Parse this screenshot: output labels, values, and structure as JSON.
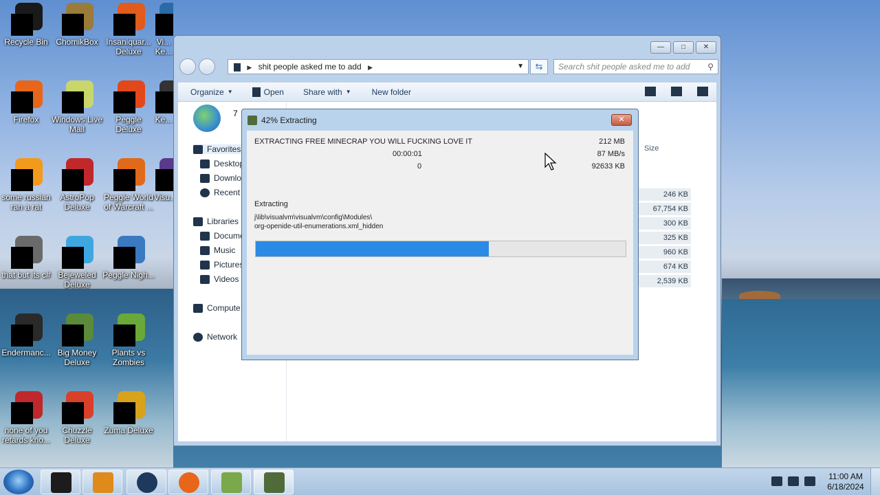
{
  "desktop": {
    "icons": [
      {
        "label": "Recycle Bin",
        "color": "#1a1a1a"
      },
      {
        "label": "ChomikBox",
        "color": "#9a7b3a"
      },
      {
        "label": "Insaniquar... Deluxe",
        "color": "#e25a1c"
      },
      {
        "label": "Vi... Ke...",
        "color": "#2a6aa8"
      },
      {
        "label": "Firefox",
        "color": "#e8661a"
      },
      {
        "label": "Windows Live Mail",
        "color": "#c9d66b"
      },
      {
        "label": "Peggle Deluxe",
        "color": "#e2481a"
      },
      {
        "label": "Ke...",
        "color": "#333333"
      },
      {
        "label": "some russian ran a rat",
        "color": "#f29a1c"
      },
      {
        "label": "AstroPop Deluxe",
        "color": "#c0282c"
      },
      {
        "label": "Peggle World of Warcraft ...",
        "color": "#e06a1a"
      },
      {
        "label": "Visu...",
        "color": "#5a3a8a"
      },
      {
        "label": "that but its c#",
        "color": "#6a6a6a"
      },
      {
        "label": "Bejeweled Deluxe",
        "color": "#3fa7e0"
      },
      {
        "label": "Peggle Nigh...",
        "color": "#3a7ac0"
      },
      {
        "label": "Endermanc...",
        "color": "#2a2a2a"
      },
      {
        "label": "Big Money Deluxe",
        "color": "#5a8a3a"
      },
      {
        "label": "Plants vs Zombies",
        "color": "#6aa83a"
      },
      {
        "label": "none of you retards kno...",
        "color": "#c0282c"
      },
      {
        "label": "Chuzzle Deluxe",
        "color": "#d8402a"
      },
      {
        "label": "Zuma Deluxe",
        "color": "#d8a21a"
      }
    ]
  },
  "explorer": {
    "window_buttons": {
      "minimize": "—",
      "maximize": "□",
      "close": "✕"
    },
    "address": {
      "path": "shit people asked me to add"
    },
    "search": {
      "placeholder": "Search shit people asked me to add"
    },
    "toolbar": {
      "organize": "Organize",
      "open": "Open",
      "share_with": "Share with",
      "new_folder": "New folder"
    },
    "folder_header": "7",
    "nav": {
      "favorites": "Favorites",
      "desktop": "Desktop",
      "downloads": "Downlo",
      "recent": "Recent P",
      "libraries": "Libraries",
      "documents": "Docume",
      "music": "Music",
      "pictures": "Pictures",
      "videos": "Videos",
      "computer": "Compute",
      "network": "Network"
    },
    "columns": {
      "size": "Size"
    },
    "sizes": [
      "246 KB",
      "67,754 KB",
      "300 KB",
      "325 KB",
      "960 KB",
      "674 KB",
      "2,539 KB"
    ]
  },
  "dialog": {
    "title": "42% Extracting",
    "close": "✕",
    "archive_name": "EXTRACTING FREE MINECRAP YOU WILL FUCKING LOVE IT",
    "elapsed": "00:00:01",
    "errors": "0",
    "total_size": "212 MB",
    "speed": "87 MB/s",
    "processed": "92633 KB",
    "status": "Extracting",
    "file_path_1": "j\\lib\\visualvm\\visualvm\\config\\Modules\\",
    "file_path_2": "org-openide-util-enumerations.xml_hidden",
    "progress": 0.63
  },
  "taskbar": {
    "time": "11:00 AM",
    "date": "6/18/2024"
  }
}
